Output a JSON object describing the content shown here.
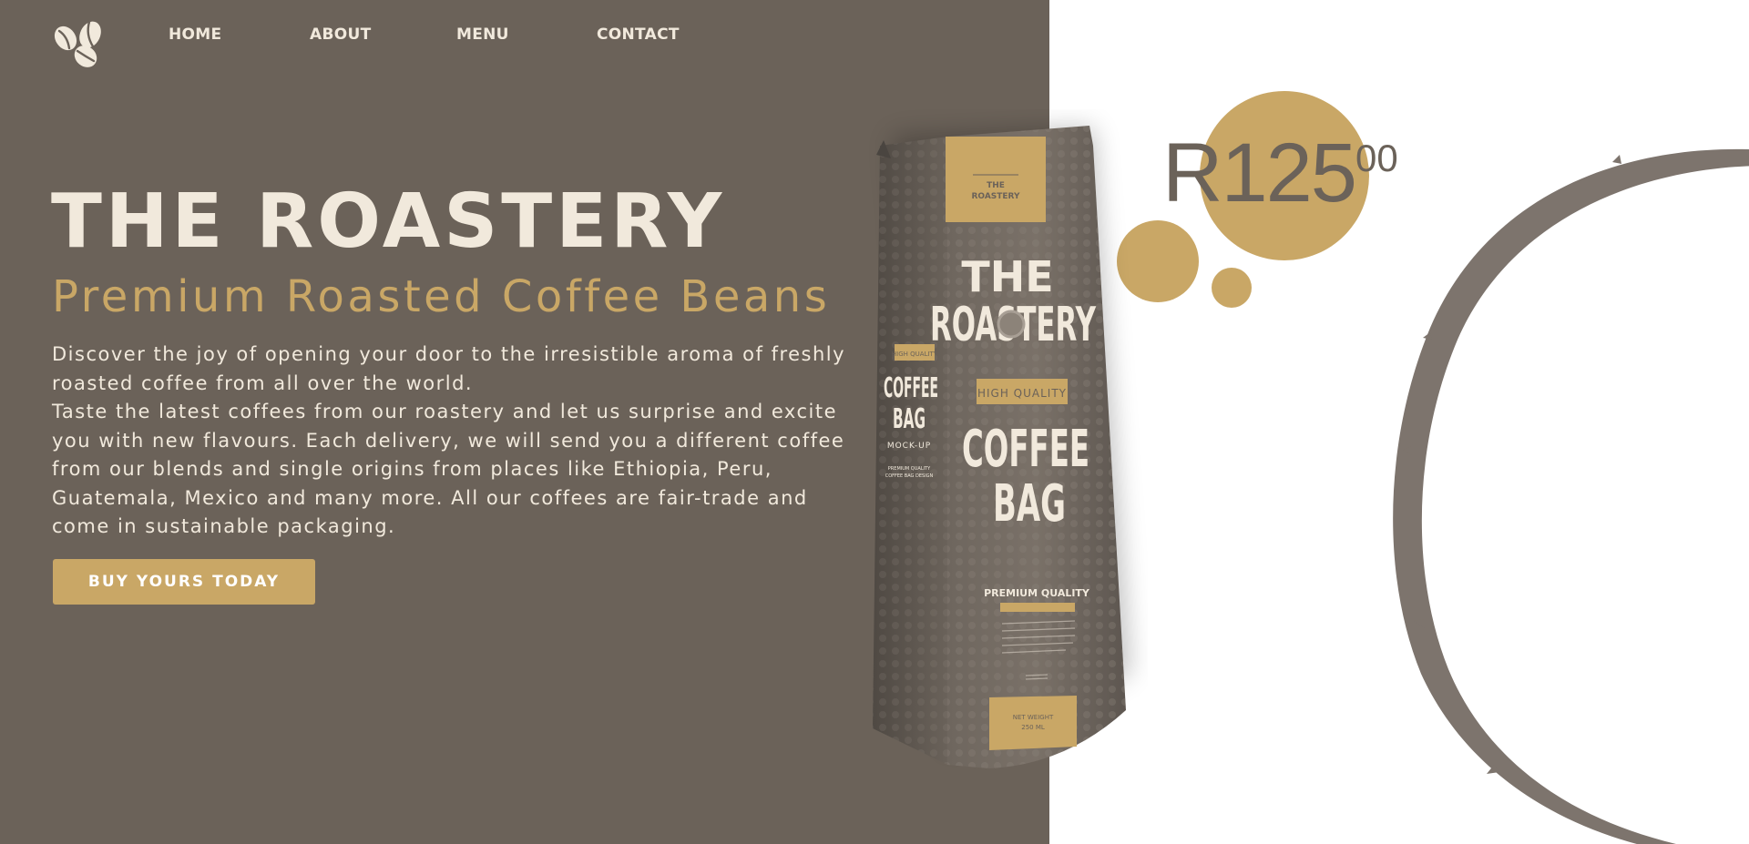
{
  "nav": {
    "logo_icon": "coffee-beans-icon",
    "links": [
      "HOME",
      "ABOUT",
      "MENU",
      "CONTACT"
    ]
  },
  "hero": {
    "title": "THE ROASTERY",
    "subtitle": "Premium Roasted Coffee Beans",
    "paragraph_1": "Discover the joy of opening your door to the irresistible aroma of freshly\nroasted coffee from all over the world.",
    "paragraph_2": "Taste the latest coffees from our roastery and let us surprise and excite\nyou with new flavours. Each delivery, we will send you a different coffee\nfrom our blends and single origins from places like Ethiopia, Peru,\nGuatemala, Mexico and many more. All our coffees are fair-trade and\ncome in sustainable packaging.",
    "cta_label": "BUY YOURS TODAY"
  },
  "price": {
    "main": "R125",
    "cents": "00"
  },
  "bag": {
    "top_label_1": "THE",
    "top_label_2": "ROASTERY",
    "brand_line_1": "THE",
    "brand_line_2": "ROASTERY",
    "quality_badge": "HIGH QUALITY",
    "product_line_1": "COFFEE",
    "product_line_2": "BAG",
    "side_badge": "HIGH QUALITY",
    "side_line_1": "COFFEE",
    "side_line_2": "BAG",
    "side_mockup": "MOCK-UP",
    "side_small_1": "PREMIUM QUALITY",
    "side_small_2": "COFFEE BAG DESIGN",
    "premium": "PREMIUM QUALITY",
    "net_weight": "NET WEIGHT",
    "weight_value": "250 ML"
  },
  "colors": {
    "panel": "#6b6259",
    "accent": "#c9a766",
    "cream": "#f1e9dc",
    "ring": "#7d746d"
  }
}
